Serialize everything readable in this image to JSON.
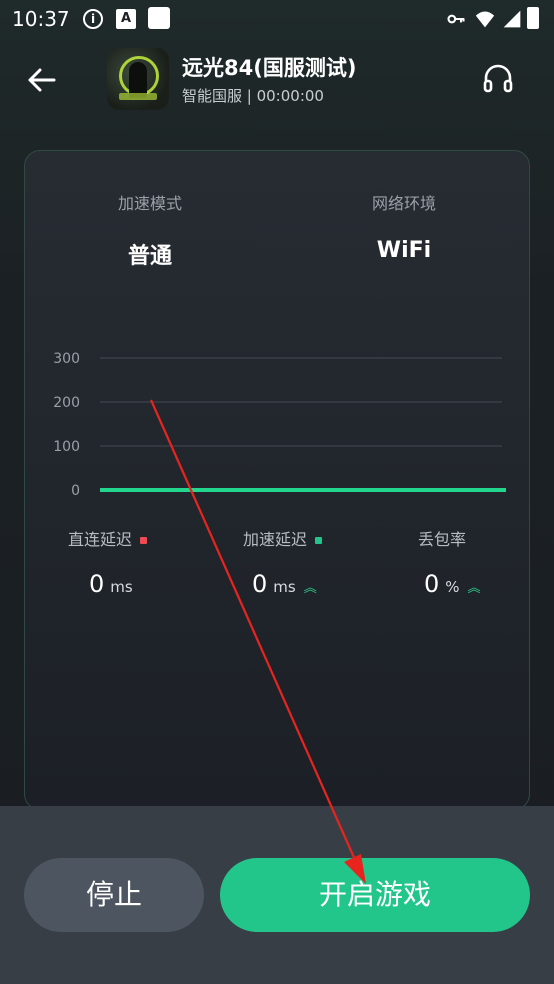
{
  "status_bar": {
    "time": "10:37",
    "icons": [
      "info-icon",
      "a-letter-icon",
      "notification-square-icon",
      "key-icon",
      "wifi-icon",
      "signal-icon",
      "battery-icon"
    ]
  },
  "header": {
    "back_icon": "arrow-left-icon",
    "game_title": "远光84(国服测试)",
    "game_subtitle": "智能国服 | 00:00:00",
    "support_icon": "headset-icon"
  },
  "card": {
    "mode_label": "加速模式",
    "mode_value": "普通",
    "network_label": "网络环境",
    "network_value": "WiFi"
  },
  "chart_data": {
    "type": "line",
    "yticks": [
      "300",
      "200",
      "100",
      "0"
    ],
    "ylim": [
      0,
      300
    ],
    "series": [
      {
        "values": [
          0,
          0,
          0,
          0,
          0,
          0,
          0,
          0
        ],
        "color": "#22d68e"
      }
    ]
  },
  "stats": {
    "direct_label": "直连延迟",
    "direct_value": "0",
    "direct_unit": "ms",
    "direct_color": "#f04b55",
    "boost_label": "加速延迟",
    "boost_value": "0",
    "boost_unit": "ms",
    "boost_color": "#22c68b",
    "loss_label": "丢包率",
    "loss_value": "0",
    "loss_unit": "%"
  },
  "actions": {
    "stop_label": "停止",
    "start_label": "开启游戏"
  },
  "colors": {
    "accent": "#22c68b",
    "annotation_arrow": "#e8241f"
  }
}
